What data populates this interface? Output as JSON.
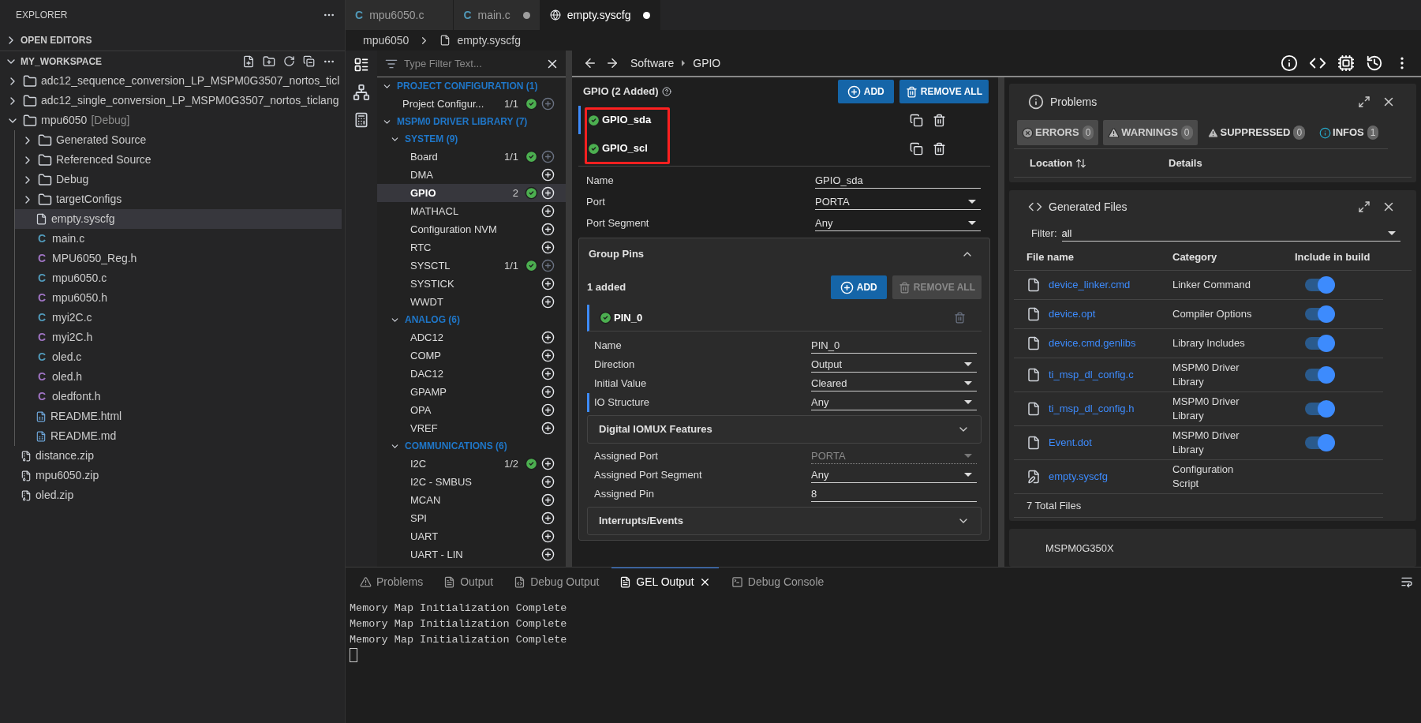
{
  "explorer": {
    "title": "EXPLORER",
    "sections": [
      {
        "label": "OPEN EDITORS",
        "expanded": false
      },
      {
        "label": "MY_WORKSPACE",
        "expanded": true
      }
    ],
    "tree": [
      {
        "label": "adc12_sequence_conversion_LP_MSPM0G3507_nortos_ticl",
        "kind": "project",
        "expanded": false,
        "selected": false
      },
      {
        "label": "adc12_single_conversion_LP_MSPM0G3507_nortos_ticlang",
        "kind": "project",
        "expanded": false,
        "selected": false
      },
      {
        "label": "mpu6050",
        "suffix": "[Debug]",
        "kind": "project",
        "expanded": true,
        "selected": false,
        "children": [
          {
            "label": "Generated Source",
            "kind": "folder",
            "expanded": false,
            "selected": false
          },
          {
            "label": "Referenced Source",
            "kind": "folder",
            "expanded": false,
            "selected": false
          },
          {
            "label": "Debug",
            "kind": "folder",
            "expanded": false,
            "selected": false
          },
          {
            "label": "targetConfigs",
            "kind": "folder",
            "expanded": false,
            "selected": false
          },
          {
            "label": "empty.syscfg",
            "kind": "page",
            "selected": true
          },
          {
            "label": "main.c",
            "kind": "c-source",
            "icon": "C",
            "selected": false
          },
          {
            "label": "MPU6050_Reg.h",
            "kind": "c-header",
            "icon": "C",
            "selected": false
          },
          {
            "label": "mpu6050.c",
            "kind": "c-source",
            "icon": "C",
            "selected": false
          },
          {
            "label": "mpu6050.h",
            "kind": "c-header",
            "icon": "C",
            "selected": false
          },
          {
            "label": "myi2C.c",
            "kind": "c-source",
            "icon": "C",
            "selected": false
          },
          {
            "label": "myi2C.h",
            "kind": "c-header",
            "icon": "C",
            "selected": false
          },
          {
            "label": "oled.c",
            "kind": "c-source",
            "icon": "C",
            "selected": false
          },
          {
            "label": "oled.h",
            "kind": "c-header",
            "icon": "C",
            "selected": false
          },
          {
            "label": "oledfont.h",
            "kind": "c-header",
            "icon": "C",
            "selected": false
          },
          {
            "label": "README.html",
            "kind": "readme",
            "selected": false
          },
          {
            "label": "README.md",
            "kind": "readme",
            "selected": false
          }
        ]
      },
      {
        "label": "distance.zip",
        "kind": "zip",
        "selected": false
      },
      {
        "label": "mpu6050.zip",
        "kind": "zip",
        "selected": false
      },
      {
        "label": "oled.zip",
        "kind": "zip",
        "selected": false
      }
    ]
  },
  "editor_tabs": [
    {
      "label": "mpu6050.c",
      "icon": "C",
      "kind": "c",
      "modified": false,
      "selected": false
    },
    {
      "label": "main.c",
      "icon": "C",
      "kind": "c",
      "modified": true,
      "selected": false
    },
    {
      "label": "empty.syscfg",
      "kind": "globe",
      "modified": true,
      "selected": true
    }
  ],
  "breadcrumb": [
    "mpu6050",
    "empty.syscfg"
  ],
  "module_tree": {
    "filter_placeholder": "Type Filter Text...",
    "groups": [
      {
        "label": "PROJECT CONFIGURATION (1)",
        "items": [
          {
            "label": "Project Configur...",
            "count": "1/1",
            "added": true,
            "can_add": false,
            "selected": false
          }
        ]
      },
      {
        "label": "MSPM0 DRIVER LIBRARY (7)",
        "subgroups": [
          {
            "label": "SYSTEM (9)",
            "items": [
              {
                "label": "Board",
                "count": "1/1",
                "added": true,
                "can_add": false,
                "selected": false
              },
              {
                "label": "DMA",
                "added": false,
                "can_add": true,
                "selected": false
              },
              {
                "label": "GPIO",
                "count": "2",
                "added": true,
                "can_add": true,
                "selected": true
              },
              {
                "label": "MATHACL",
                "added": false,
                "can_add": true,
                "selected": false
              },
              {
                "label": "Configuration NVM",
                "added": false,
                "can_add": true,
                "selected": false
              },
              {
                "label": "RTC",
                "added": false,
                "can_add": true,
                "selected": false
              },
              {
                "label": "SYSCTL",
                "count": "1/1",
                "added": true,
                "can_add": false,
                "selected": false
              },
              {
                "label": "SYSTICK",
                "added": false,
                "can_add": true,
                "selected": false
              },
              {
                "label": "WWDT",
                "added": false,
                "can_add": true,
                "selected": false
              }
            ]
          },
          {
            "label": "ANALOG (6)",
            "items": [
              {
                "label": "ADC12",
                "added": false,
                "can_add": true,
                "selected": false
              },
              {
                "label": "COMP",
                "added": false,
                "can_add": true,
                "selected": false
              },
              {
                "label": "DAC12",
                "added": false,
                "can_add": true,
                "selected": false
              },
              {
                "label": "GPAMP",
                "added": false,
                "can_add": true,
                "selected": false
              },
              {
                "label": "OPA",
                "added": false,
                "can_add": true,
                "selected": false
              },
              {
                "label": "VREF",
                "added": false,
                "can_add": true,
                "selected": false
              }
            ]
          },
          {
            "label": "COMMUNICATIONS (6)",
            "items": [
              {
                "label": "I2C",
                "count": "1/2",
                "added": true,
                "can_add": true,
                "selected": false
              },
              {
                "label": "I2C - SMBUS",
                "added": false,
                "can_add": true,
                "selected": false
              },
              {
                "label": "MCAN",
                "added": false,
                "can_add": true,
                "selected": false
              },
              {
                "label": "SPI",
                "added": false,
                "can_add": true,
                "selected": false
              },
              {
                "label": "UART",
                "added": false,
                "can_add": true,
                "selected": false
              },
              {
                "label": "UART - LIN",
                "added": false,
                "can_add": true,
                "selected": false
              }
            ]
          }
        ]
      }
    ]
  },
  "nav": [
    "Software",
    "GPIO"
  ],
  "gpio": {
    "title": "GPIO (2 Added)",
    "add_label": "ADD",
    "remove_all_label": "REMOVE ALL",
    "instances": [
      {
        "name": "GPIO_sda",
        "selected": true
      },
      {
        "name": "GPIO_scl",
        "selected": false
      }
    ],
    "fields": [
      {
        "label": "Name",
        "value": "GPIO_sda",
        "kind": "text"
      },
      {
        "label": "Port",
        "value": "PORTA",
        "kind": "select"
      },
      {
        "label": "Port Segment",
        "value": "Any",
        "kind": "select"
      }
    ],
    "group_pins": {
      "title": "Group Pins",
      "expanded": true,
      "count": "1 added",
      "add_label": "ADD",
      "remove_all_label": "REMOVE ALL",
      "remove_all_disabled": true,
      "pins": [
        {
          "name": "PIN_0",
          "selected": true
        }
      ],
      "fields": [
        {
          "label": "Name",
          "value": "PIN_0",
          "kind": "text",
          "flagged": false
        },
        {
          "label": "Direction",
          "value": "Output",
          "kind": "select",
          "flagged": false
        },
        {
          "label": "Initial Value",
          "value": "Cleared",
          "kind": "select",
          "flagged": false
        },
        {
          "label": "IO Structure",
          "value": "Any",
          "kind": "select",
          "flagged": true
        }
      ],
      "iomux": {
        "title": "Digital IOMUX Features",
        "expanded": false
      },
      "assigned": [
        {
          "label": "Assigned Port",
          "value": "PORTA",
          "kind": "select",
          "disabled": true
        },
        {
          "label": "Assigned Port Segment",
          "value": "Any",
          "kind": "select",
          "disabled": false
        },
        {
          "label": "Assigned Pin",
          "value": "8",
          "kind": "text",
          "disabled": false
        }
      ],
      "interrupts": {
        "title": "Interrupts/Events",
        "expanded": false
      }
    }
  },
  "problems": {
    "title": "Problems",
    "filters": [
      {
        "label": "ERRORS",
        "count": "0",
        "kind": "error",
        "selected": true
      },
      {
        "label": "WARNINGS",
        "count": "0",
        "kind": "warning",
        "selected": true
      },
      {
        "label": "SUPPRESSED",
        "count": "0",
        "kind": "suppressed",
        "selected": false
      },
      {
        "label": "INFOS",
        "count": "1",
        "kind": "info",
        "selected": false
      }
    ],
    "columns": [
      "Location",
      "Details"
    ]
  },
  "generated_files": {
    "title": "Generated Files",
    "filter_label": "Filter:",
    "filter_value": "all",
    "columns": [
      "File name",
      "Category",
      "Include in build"
    ],
    "files": [
      {
        "name": "device_linker.cmd",
        "category": "Linker Command",
        "kind": "file",
        "include": true
      },
      {
        "name": "device.opt",
        "category": "Compiler Options",
        "kind": "file",
        "include": true
      },
      {
        "name": "device.cmd.genlibs",
        "category": "Library Includes",
        "kind": "file",
        "include": true
      },
      {
        "name": "ti_msp_dl_config.c",
        "category": "MSPM0 Driver Library",
        "kind": "file",
        "include": true
      },
      {
        "name": "ti_msp_dl_config.h",
        "category": "MSPM0 Driver Library",
        "kind": "file",
        "include": true
      },
      {
        "name": "Event.dot",
        "category": "MSPM0 Driver Library",
        "kind": "file",
        "include": true
      },
      {
        "name": "empty.syscfg",
        "category": "Configuration Script",
        "kind": "script"
      }
    ],
    "total": "7 Total Files"
  },
  "device_panel": {
    "title": "MSPM0G350X"
  },
  "bottom_panel": {
    "tabs": [
      {
        "label": "Problems",
        "kind": "problems",
        "selected": false
      },
      {
        "label": "Output",
        "kind": "output",
        "selected": false
      },
      {
        "label": "Debug Output",
        "kind": "debug",
        "selected": false
      },
      {
        "label": "GEL Output",
        "kind": "gel",
        "selected": true
      },
      {
        "label": "Debug Console",
        "kind": "console",
        "selected": false
      }
    ],
    "lines": [
      "Memory Map Initialization Complete",
      "Memory Map Initialization Complete",
      "Memory Map Initialization Complete"
    ],
    "cursor": true
  }
}
